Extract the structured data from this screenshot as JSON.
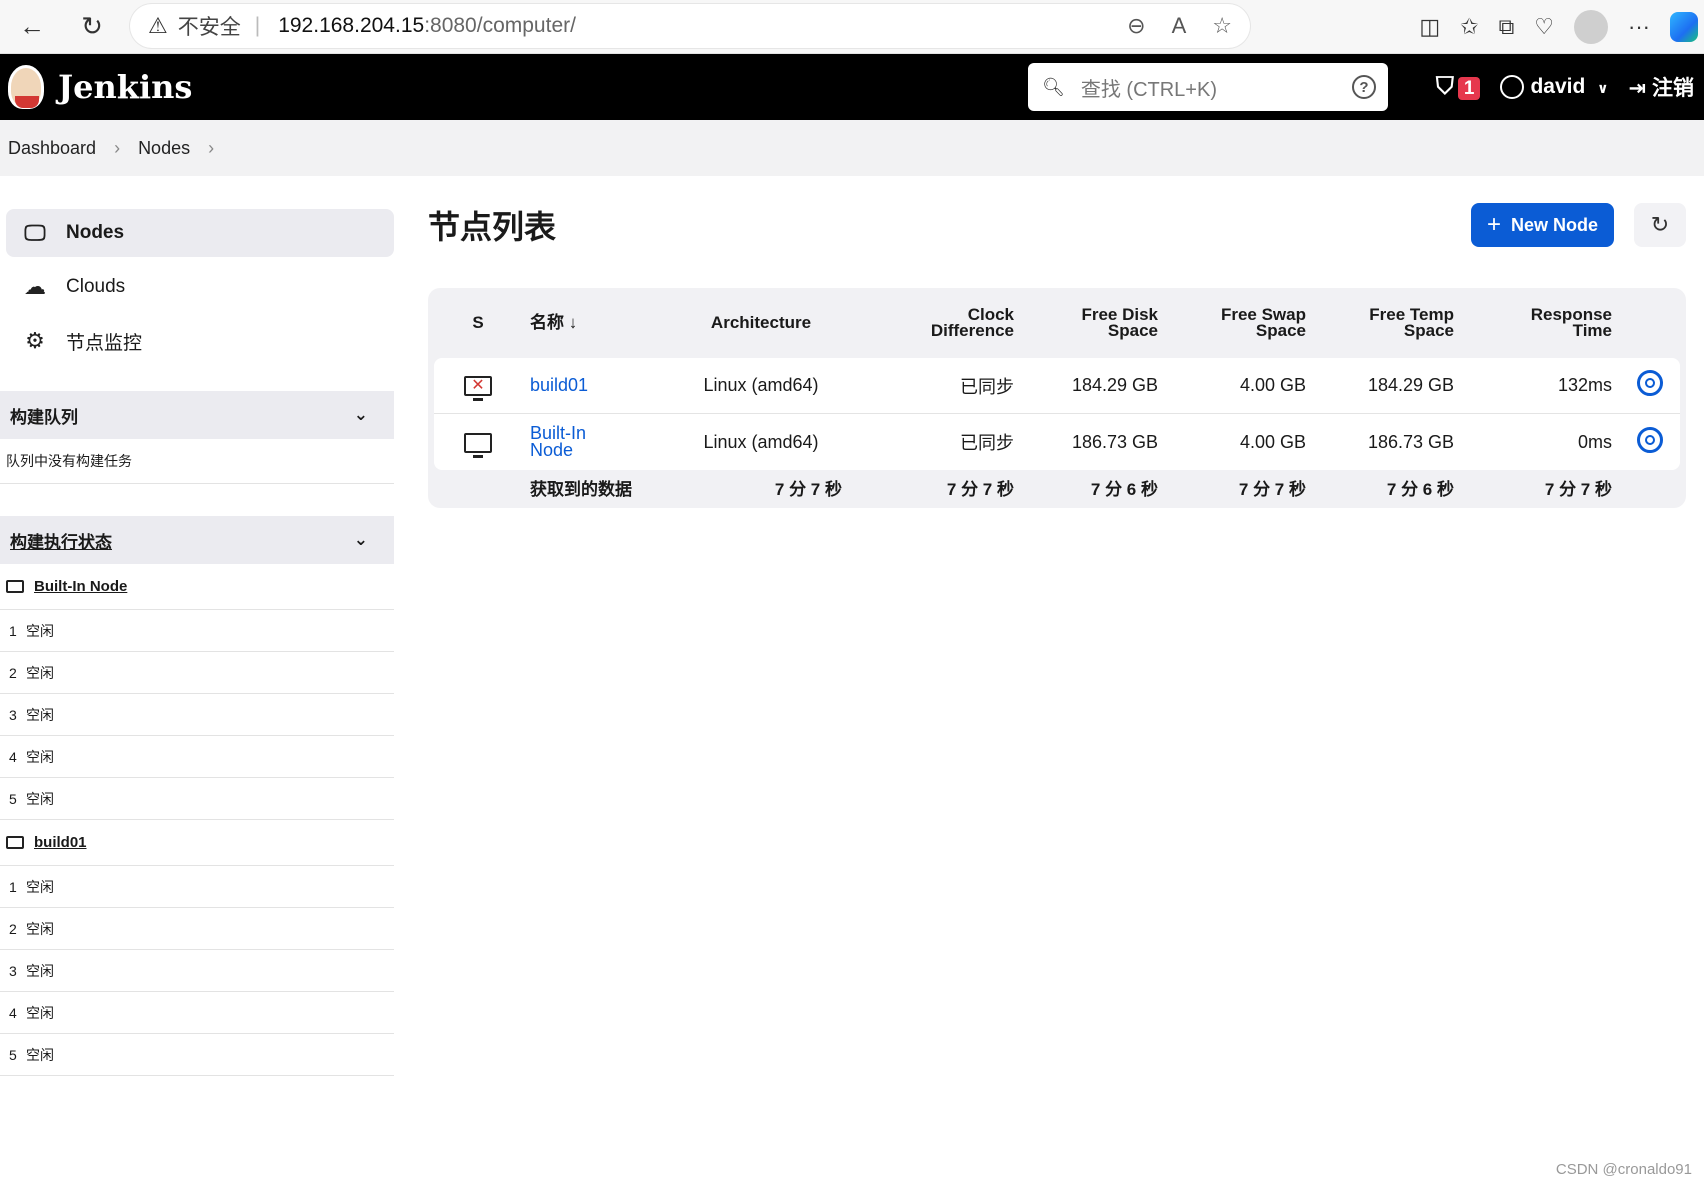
{
  "browser": {
    "insecure_label": "不安全",
    "url_host": "192.168.204.15",
    "url_path": ":8080/computer/"
  },
  "header": {
    "brand": "Jenkins",
    "search_placeholder": "查找 (CTRL+K)",
    "security_count": "1",
    "user": "david",
    "logout": "注销"
  },
  "breadcrumb": [
    "Dashboard",
    "Nodes"
  ],
  "sidebar": {
    "tasks": [
      {
        "label": "Nodes",
        "icon": "monitor-icon",
        "active": true
      },
      {
        "label": "Clouds",
        "icon": "cloud-icon",
        "active": false
      },
      {
        "label": "节点监控",
        "icon": "gear-icon",
        "active": false
      }
    ],
    "queue": {
      "title": "构建队列",
      "empty": "队列中没有构建任务"
    },
    "executors": {
      "title": "构建执行状态",
      "nodes": [
        {
          "name": "Built-In Node",
          "slots": [
            {
              "n": "1",
              "s": "空闲"
            },
            {
              "n": "2",
              "s": "空闲"
            },
            {
              "n": "3",
              "s": "空闲"
            },
            {
              "n": "4",
              "s": "空闲"
            },
            {
              "n": "5",
              "s": "空闲"
            }
          ]
        },
        {
          "name": "build01",
          "slots": [
            {
              "n": "1",
              "s": "空闲"
            },
            {
              "n": "2",
              "s": "空闲"
            },
            {
              "n": "3",
              "s": "空闲"
            },
            {
              "n": "4",
              "s": "空闲"
            },
            {
              "n": "5",
              "s": "空闲"
            }
          ]
        }
      ]
    }
  },
  "main": {
    "title": "节点列表",
    "new_node": "New Node",
    "columns": {
      "s": "S",
      "name": "名称 ↓",
      "arch": "Architecture",
      "clock1": "Clock",
      "clock2": "Difference",
      "disk1": "Free Disk",
      "disk2": "Space",
      "swap1": "Free Swap",
      "swap2": "Space",
      "temp1": "Free Temp",
      "temp2": "Space",
      "resp1": "Response",
      "resp2": "Time"
    },
    "rows": [
      {
        "name": "build01",
        "offline": true,
        "arch": "Linux (amd64)",
        "clock": "已同步",
        "disk": "184.29 GB",
        "swap": "4.00 GB",
        "temp": "184.29 GB",
        "resp": "132ms"
      },
      {
        "name1": "Built-In",
        "name2": "Node",
        "offline": false,
        "arch": "Linux (amd64)",
        "clock": "已同步",
        "disk": "186.73 GB",
        "swap": "4.00 GB",
        "temp": "186.73 GB",
        "resp": "0ms"
      }
    ],
    "footer": {
      "label": "获取到的数据",
      "arch": "7 分 7 秒",
      "clock": "7 分 7 秒",
      "disk": "7 分 6 秒",
      "swap": "7 分 7 秒",
      "temp": "7 分 6 秒",
      "resp": "7 分 7 秒"
    }
  },
  "watermark": "CSDN @cronaldo91",
  "colors": {
    "accent": "#0b5cd5",
    "header_bg": "#000000",
    "badge": "#e6374d"
  }
}
